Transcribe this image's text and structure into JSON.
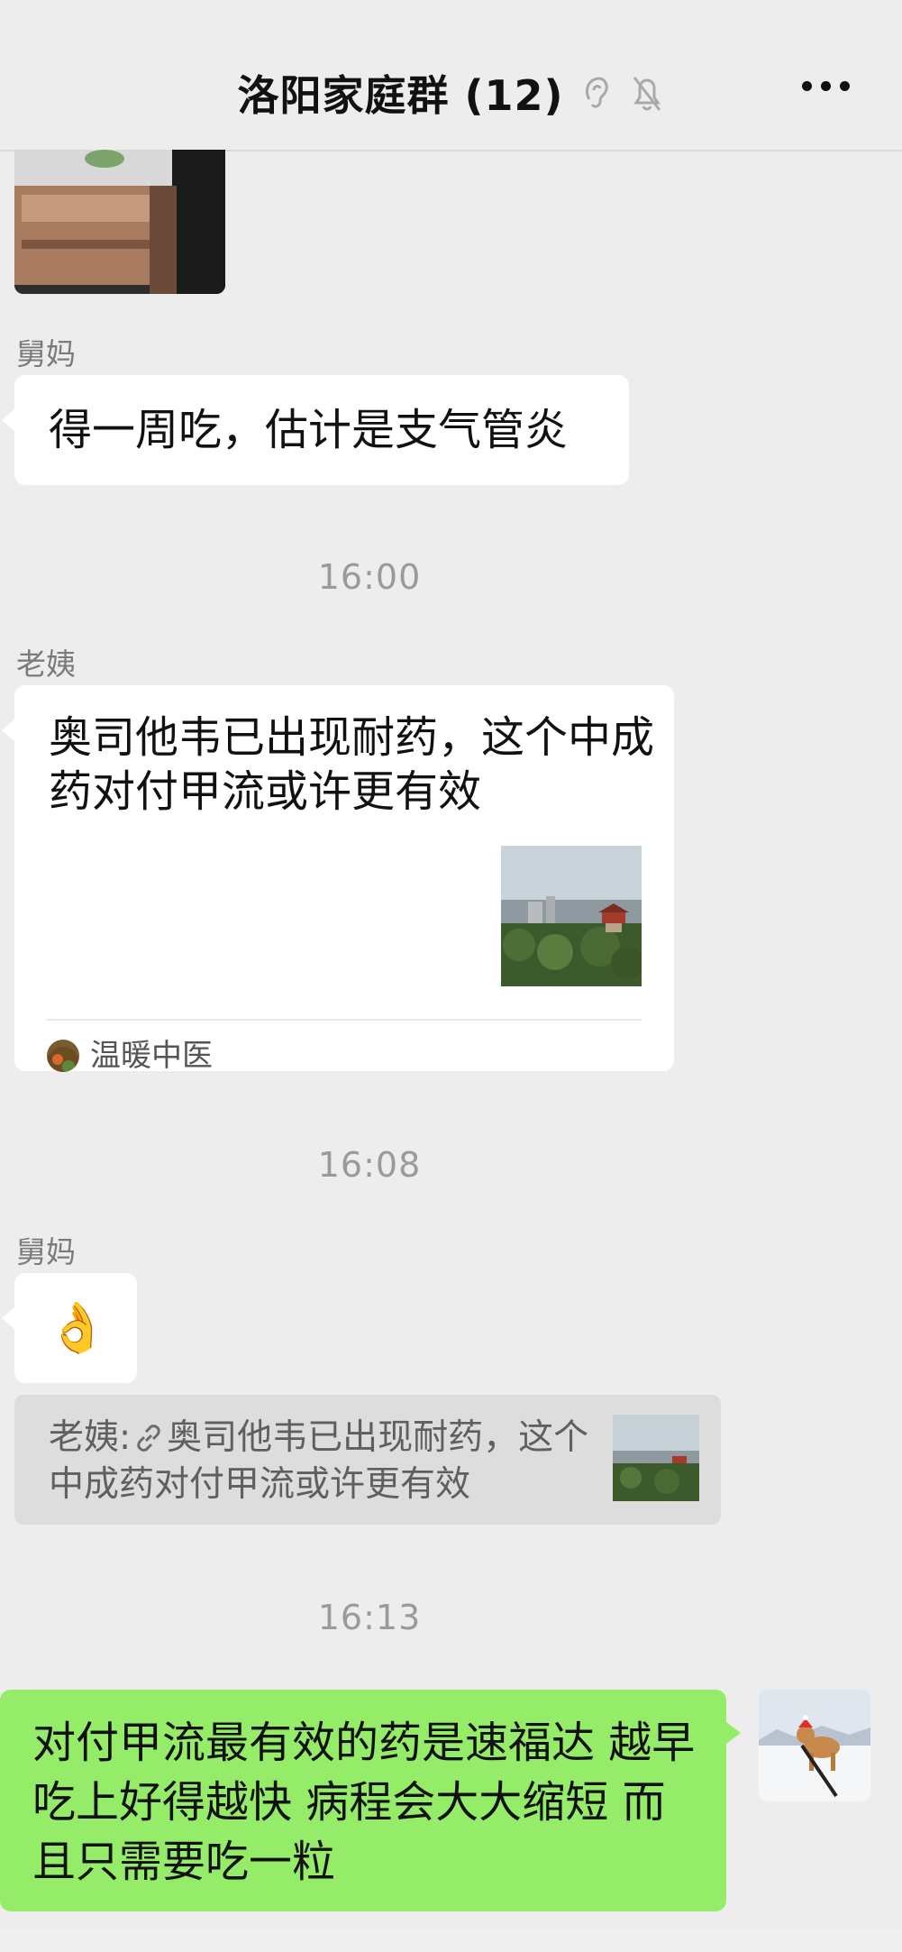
{
  "header": {
    "title": "洛阳家庭群 (12)"
  },
  "messages": {
    "m1_sender": "舅妈",
    "m1_text": "得一周吃，估计是支气管炎",
    "t1": "16:00",
    "m2_sender": "老姨",
    "m2_card_text": "奥司他韦已出现耐药，这个中成药对付甲流或许更有效",
    "m2_card_source": "温暖中医",
    "t2": "16:08",
    "m3_sender": "舅妈",
    "m3_emoji": "👌",
    "m3_quote_author": "老姨:",
    "m3_quote_text": "奥司他韦已出现耐药，这个中成药对付甲流或许更有效",
    "t3": "16:13",
    "m4_text": "对付甲流最有效的药是速福达 越早吃上好得越快 病程会大大缩短 而且只需要吃一粒"
  },
  "colors": {
    "background": "#ededed",
    "bubble_self": "#95ec69",
    "bubble_other": "#ffffff",
    "meta_text": "#9a9a9a"
  },
  "icons": [
    "ear-icon",
    "mute-bell-icon",
    "more-icon",
    "link-icon"
  ]
}
